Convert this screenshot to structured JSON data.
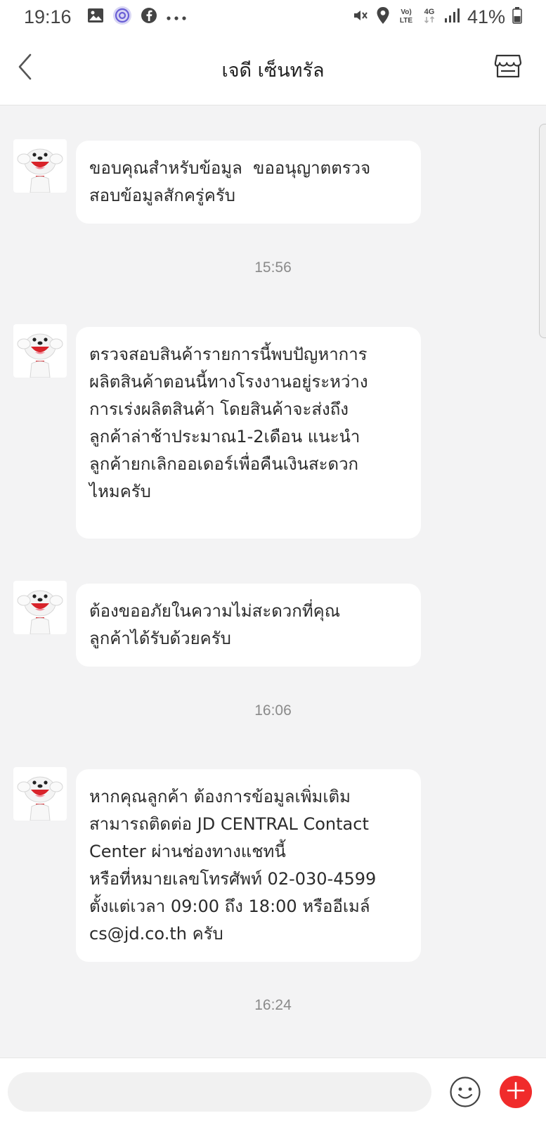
{
  "status_bar": {
    "time": "19:16",
    "left_icons": [
      "gallery-icon",
      "threads-icon",
      "facebook-icon",
      "more-icon"
    ],
    "right_icons": [
      "mute-icon",
      "location-icon",
      "volte-icon",
      "4g-icon",
      "signal-icon",
      "battery-icon"
    ],
    "volte_label": "Vo)\nLTE",
    "network_label": "4G",
    "battery_percent": "41%"
  },
  "header": {
    "title": "เจดี เซ็นทรัล",
    "back_icon": "chevron-left-icon",
    "store_icon": "store-icon"
  },
  "messages": [
    {
      "type": "message",
      "sender": "agent",
      "text": "ขอบคุณสำหรับข้อมูล  ขออนุญาตตรวจ\nสอบข้อมูลสักครู่ครับ"
    },
    {
      "type": "timestamp",
      "text": "15:56"
    },
    {
      "type": "message",
      "sender": "agent",
      "text": "ตรวจสอบสินค้ารายการนี้พบปัญหาการ\nผลิตสินค้าตอนนี้ทางโรงงานอยู่ระหว่าง\nการเร่งผลิตสินค้า โดยสินค้าจะส่งถึง\nลูกค้าล่าช้าประมาณ1-2เดือน แนะนำ\nลูกค้ายกเลิกออเดอร์เพื่อคืนเงินสะดวก\nไหมครับ"
    },
    {
      "type": "message",
      "sender": "agent",
      "text": "ต้องขออภัยในความไม่สะดวกที่คุณ\nลูกค้าได้รับด้วยครับ"
    },
    {
      "type": "timestamp",
      "text": "16:06"
    },
    {
      "type": "message",
      "sender": "agent",
      "text": "หากคุณลูกค้า ต้องการข้อมูลเพิ่มเติม\nสามารถติดต่อ JD CENTRAL Contact\nCenter ผ่านช่องทางแชทนี้\nหรือที่หมายเลขโทรศัพท์ 02-030-4599\nตั้งแต่เวลา 09:00 ถึง 18:00 หรืออีเมล์\ncs@jd.co.th ครับ"
    },
    {
      "type": "timestamp",
      "text": "16:24"
    }
  ],
  "input_bar": {
    "placeholder": "",
    "emoji_icon": "emoji-icon",
    "add_icon": "plus-icon"
  },
  "colors": {
    "accent": "#f02b2b",
    "background": "#f3f3f4",
    "bubble": "#ffffff",
    "timestamp_text": "#8a8a8a"
  }
}
